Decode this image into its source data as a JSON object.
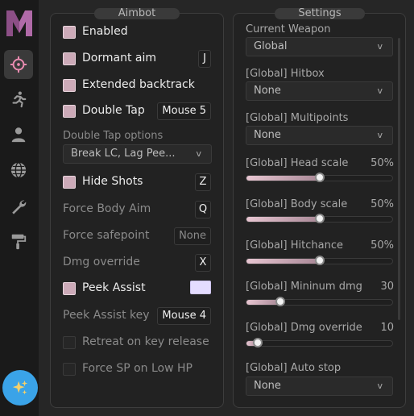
{
  "colors": {
    "accent": "#ccaab8",
    "peek_assist_color": "#e4dcff",
    "magic_button": "#3aa3e8",
    "logo": "#b06aa8"
  },
  "sidebar": {
    "items": [
      {
        "name": "crosshair-icon",
        "active": true
      },
      {
        "name": "running-person-icon",
        "active": false
      },
      {
        "name": "user-icon",
        "active": false
      },
      {
        "name": "globe-icon",
        "active": false
      },
      {
        "name": "wrench-icon",
        "active": false
      },
      {
        "name": "paint-roller-icon",
        "active": false
      }
    ],
    "bottom_button": {
      "icon": "sparkles-icon"
    }
  },
  "aimbot": {
    "title": "Aimbot",
    "enabled": {
      "label": "Enabled",
      "checked": true
    },
    "dormant_aim": {
      "label": "Dormant aim",
      "checked": true,
      "key": "J"
    },
    "extended_backtrack": {
      "label": "Extended backtrack",
      "checked": true
    },
    "double_tap": {
      "label": "Double Tap",
      "checked": true,
      "key": "Mouse 5"
    },
    "double_tap_options": {
      "label": "Double Tap options",
      "value": "Break LC, Lag Pee..."
    },
    "hide_shots": {
      "label": "Hide Shots",
      "checked": true,
      "key": "Z"
    },
    "force_body_aim": {
      "label": "Force Body Aim",
      "key": "Q"
    },
    "force_safepoint": {
      "label": "Force safepoint",
      "key": "None"
    },
    "dmg_override": {
      "label": "Dmg override",
      "key": "X"
    },
    "peek_assist": {
      "label": "Peek Assist",
      "checked": true
    },
    "peek_assist_key": {
      "label": "Peek Assist key",
      "key": "Mouse 4"
    },
    "retreat": {
      "label": "Retreat on key release",
      "checked": false
    },
    "force_sp": {
      "label": "Force SP on Low HP",
      "checked": false
    }
  },
  "settings": {
    "title": "Settings",
    "current_weapon": {
      "label": "Current Weapon",
      "value": "Global"
    },
    "hitbox": {
      "label": "[Global] Hitbox",
      "value": "None"
    },
    "multipoints": {
      "label": "[Global] Multipoints",
      "value": "None"
    },
    "head_scale": {
      "label": "[Global] Head scale",
      "value": 50,
      "max": 100,
      "display": "50%"
    },
    "body_scale": {
      "label": "[Global] Body scale",
      "value": 50,
      "max": 100,
      "display": "50%"
    },
    "hitchance": {
      "label": "[Global] Hitchance",
      "value": 50,
      "max": 100,
      "display": "50%"
    },
    "min_dmg": {
      "label": "[Global] Mininum dmg",
      "value": 30,
      "max": 130,
      "display": "30"
    },
    "dmg_override": {
      "label": "[Global] Dmg override",
      "value": 10,
      "max": 130,
      "display": "10"
    },
    "auto_stop": {
      "label": "[Global] Auto stop",
      "value": "None"
    }
  }
}
